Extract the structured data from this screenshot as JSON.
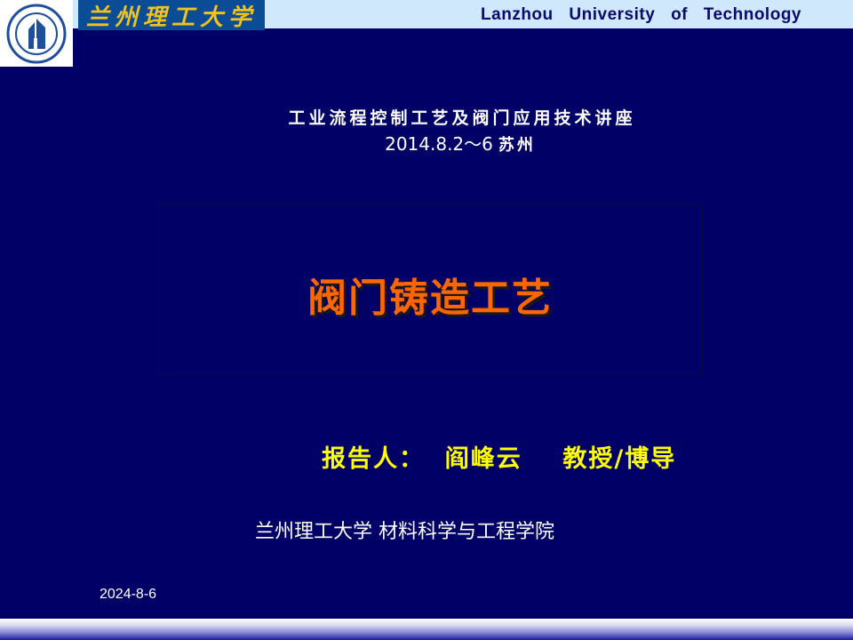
{
  "header": {
    "logo_icon": "university-seal-icon",
    "banner_text": "兰州理工大学",
    "university_en": "Lanzhou University of Technology",
    "colors": {
      "top_band": "#cfe8fb",
      "banner_bg": "#0a4c96",
      "banner_text": "#f2c21b",
      "background": "#000066"
    }
  },
  "lecture": {
    "series_title": "工业流程控制工艺及阀门应用技术讲座",
    "date_range": "2014.8.2～6",
    "city": "苏州"
  },
  "main": {
    "title": "阀门铸造工艺",
    "title_color": "#ff6600"
  },
  "presenter": {
    "line": "报告人：  阎峰云    教授/博导",
    "color": "#ffff00"
  },
  "institute": "兰州理工大学 材料科学与工程学院",
  "footer": {
    "date": "2024-8-6"
  }
}
